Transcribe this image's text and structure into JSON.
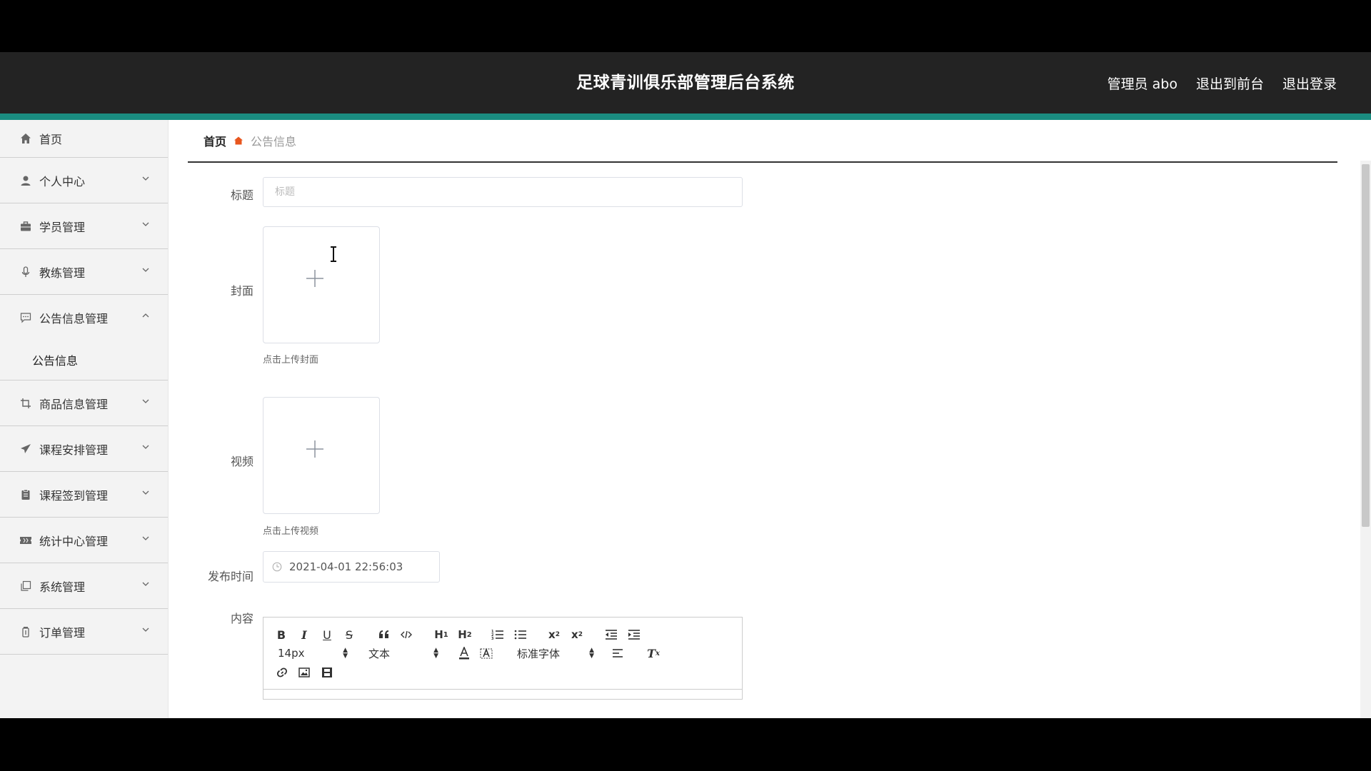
{
  "header": {
    "title": "足球青训俱乐部管理后台系统",
    "user_label": "管理员 abo",
    "to_front": "退出到前台",
    "logout": "退出登录"
  },
  "sidebar": {
    "items": [
      {
        "label": "首页",
        "icon": "home-icon"
      },
      {
        "label": "个人中心",
        "icon": "user-icon"
      },
      {
        "label": "学员管理",
        "icon": "briefcase-icon"
      },
      {
        "label": "教练管理",
        "icon": "microphone-icon"
      },
      {
        "label": "公告信息管理",
        "icon": "chat-icon",
        "expanded": true,
        "children": [
          {
            "label": "公告信息"
          }
        ]
      },
      {
        "label": "商品信息管理",
        "icon": "crop-icon"
      },
      {
        "label": "课程安排管理",
        "icon": "send-icon"
      },
      {
        "label": "课程签到管理",
        "icon": "clipboard-icon"
      },
      {
        "label": "统计中心管理",
        "icon": "ticket-icon"
      },
      {
        "label": "系统管理",
        "icon": "copy-icon"
      },
      {
        "label": "订单管理",
        "icon": "bottle-icon"
      }
    ]
  },
  "breadcrumb": {
    "home": "首页",
    "current": "公告信息"
  },
  "form": {
    "title_label": "标题",
    "title_placeholder": "标题",
    "cover_label": "封面",
    "cover_hint": "点击上传封面",
    "video_label": "视频",
    "video_hint": "点击上传视频",
    "publish_label": "发布时间",
    "publish_value": "2021-04-01 22:56:03",
    "content_label": "内容"
  },
  "editor": {
    "font_size": "14px",
    "header_select": "文本",
    "font_family": "标准字体"
  },
  "colors": {
    "accent": "#1a8c80",
    "header_bg": "#232323",
    "breadcrumb_sep": "#e8561e"
  }
}
